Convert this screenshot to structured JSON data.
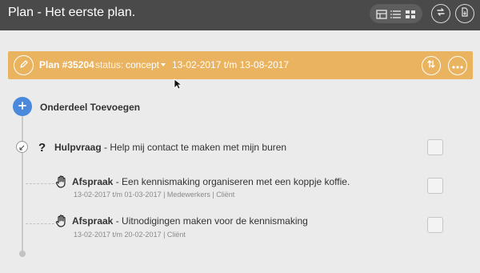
{
  "header": {
    "title": "Plan - Het eerste plan.",
    "view_icons": [
      "grid-icon",
      "list-icon",
      "tile-icon"
    ],
    "refresh_icon": "swap-icon",
    "export_icon": "document-download-icon"
  },
  "plan": {
    "id": "Plan #35204",
    "status_label": "status:",
    "status_value": "concept",
    "dates": "13-02-2017 t/m 13-08-2017",
    "color": "#e9b35f"
  },
  "add_section": {
    "label": "Onderdeel Toevoegen",
    "color": "#4a89dc"
  },
  "hulpvraag": {
    "type": "Hulpvraag",
    "text": " - Help mij contact te maken met mijn buren"
  },
  "afspraken": [
    {
      "type": "Afspraak",
      "text": " - Een kennismaking organiseren met een koppje koffie.",
      "meta": "13-02-2017 t/m 01-03-2017 | Medewerkers | Cliënt"
    },
    {
      "type": "Afspraak",
      "text": " - Uitnodigingen maken voor de kennismaking",
      "meta": "13-02-2017 t/m 20-02-2017 | Cliënt"
    }
  ]
}
